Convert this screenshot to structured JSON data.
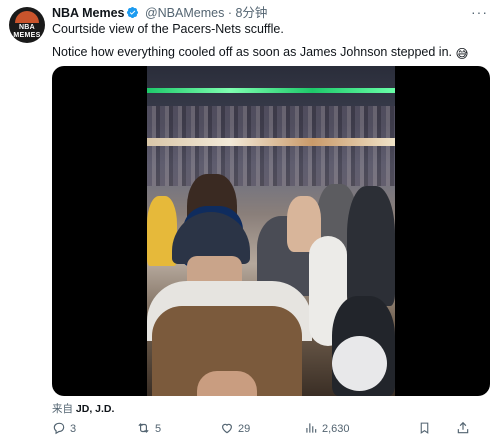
{
  "account": {
    "avatar_text": "NBA MEMES",
    "name": "NBA Memes",
    "handle": "@NBAMemes",
    "separator": "·",
    "time": "8分钟"
  },
  "tweet": {
    "line1": "Courtside view of the Pacers-Nets scuffle.",
    "line2": "Notice how everything cooled off as soon as James Johnson stepped in.",
    "emoji": "😅"
  },
  "source": {
    "label": "来自",
    "value": "JD, J.D."
  },
  "actions": {
    "replies": "3",
    "retweets": "5",
    "likes": "29",
    "views": "2,630"
  },
  "colors": {
    "verified": "#1d9bf0",
    "muted": "#536471",
    "text": "#0f1419"
  },
  "icons": [
    "verified-badge-icon",
    "more-icon",
    "reply-icon",
    "retweet-icon",
    "like-icon",
    "views-icon",
    "bookmark-icon",
    "share-icon"
  ]
}
